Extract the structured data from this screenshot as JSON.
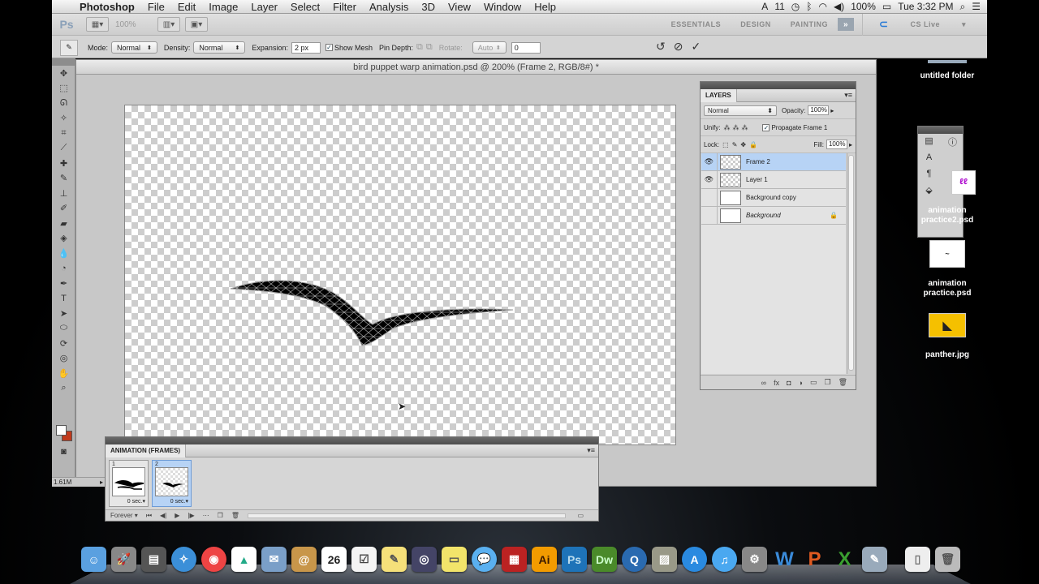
{
  "menubar": {
    "app_name": "Photoshop",
    "items": [
      "File",
      "Edit",
      "Image",
      "Layer",
      "Select",
      "Filter",
      "Analysis",
      "3D",
      "View",
      "Window",
      "Help"
    ],
    "status_num": "11",
    "battery": "100%",
    "clock": "Tue 3:32 PM"
  },
  "appbar": {
    "logo": "Ps",
    "zoom": "100%",
    "workspaces": [
      "ESSENTIALS",
      "DESIGN",
      "PAINTING"
    ],
    "cs_live": "CS Live"
  },
  "tool_options": {
    "mode_label": "Mode:",
    "mode_value": "Normal",
    "density_label": "Density:",
    "density_value": "Normal",
    "expansion_label": "Expansion:",
    "expansion_value": "2 px",
    "show_mesh_label": "Show Mesh",
    "pin_depth_label": "Pin Depth:",
    "rotate_label": "Rotate:",
    "rotate_value": "Auto",
    "rotate_angle": "0"
  },
  "document": {
    "title": "bird puppet warp animation.psd @ 200% (Frame 2, RGB/8#) *",
    "status": "1.61M"
  },
  "layers_panel": {
    "tab": "LAYERS",
    "blend_mode": "Normal",
    "opacity_label": "Opacity:",
    "opacity_value": "100%",
    "unify_label": "Unify:",
    "propagate_label": "Propagate Frame 1",
    "lock_label": "Lock:",
    "fill_label": "Fill:",
    "fill_value": "100%",
    "layers": [
      {
        "name": "Frame 2",
        "visible": true,
        "selected": true
      },
      {
        "name": "Layer 1",
        "visible": true,
        "selected": false
      },
      {
        "name": "Background copy",
        "visible": false,
        "selected": false
      },
      {
        "name": "Background",
        "visible": false,
        "selected": false,
        "locked": true
      }
    ]
  },
  "animation_panel": {
    "tab": "ANIMATION (FRAMES)",
    "frames": [
      {
        "num": "1",
        "delay": "0 sec."
      },
      {
        "num": "2",
        "delay": "0 sec."
      }
    ],
    "loop": "Forever"
  },
  "desktop_icons": [
    {
      "label": "untitled folder"
    },
    {
      "label": "animation practice2.psd"
    },
    {
      "label": "animation practice.psd"
    },
    {
      "label": "panther.jpg"
    }
  ],
  "dock": {
    "calendar_day": "26",
    "apps": [
      "finder-icon",
      "launchpad-icon",
      "system-monitor-icon",
      "safari-icon",
      "chrome-icon",
      "google-drive-icon",
      "preview-icon",
      "contacts-icon",
      "calendar-icon",
      "reminders-icon",
      "notes-icon",
      "screen-capture-icon",
      "stickies-icon",
      "messages-icon",
      "photo-booth-icon",
      "illustrator-icon",
      "photoshop-icon",
      "dreamweaver-icon",
      "quicktime-icon",
      "iphoto-icon",
      "app-store-icon",
      "itunes-icon",
      "system-preferences-icon",
      "word-icon",
      "powerpoint-icon",
      "excel-icon",
      "image-capture-icon",
      "documents-icon",
      "trash-icon"
    ],
    "app_labels": {
      "illustrator": "Ai",
      "photoshop": "Ps",
      "dreamweaver": "Dw"
    }
  }
}
